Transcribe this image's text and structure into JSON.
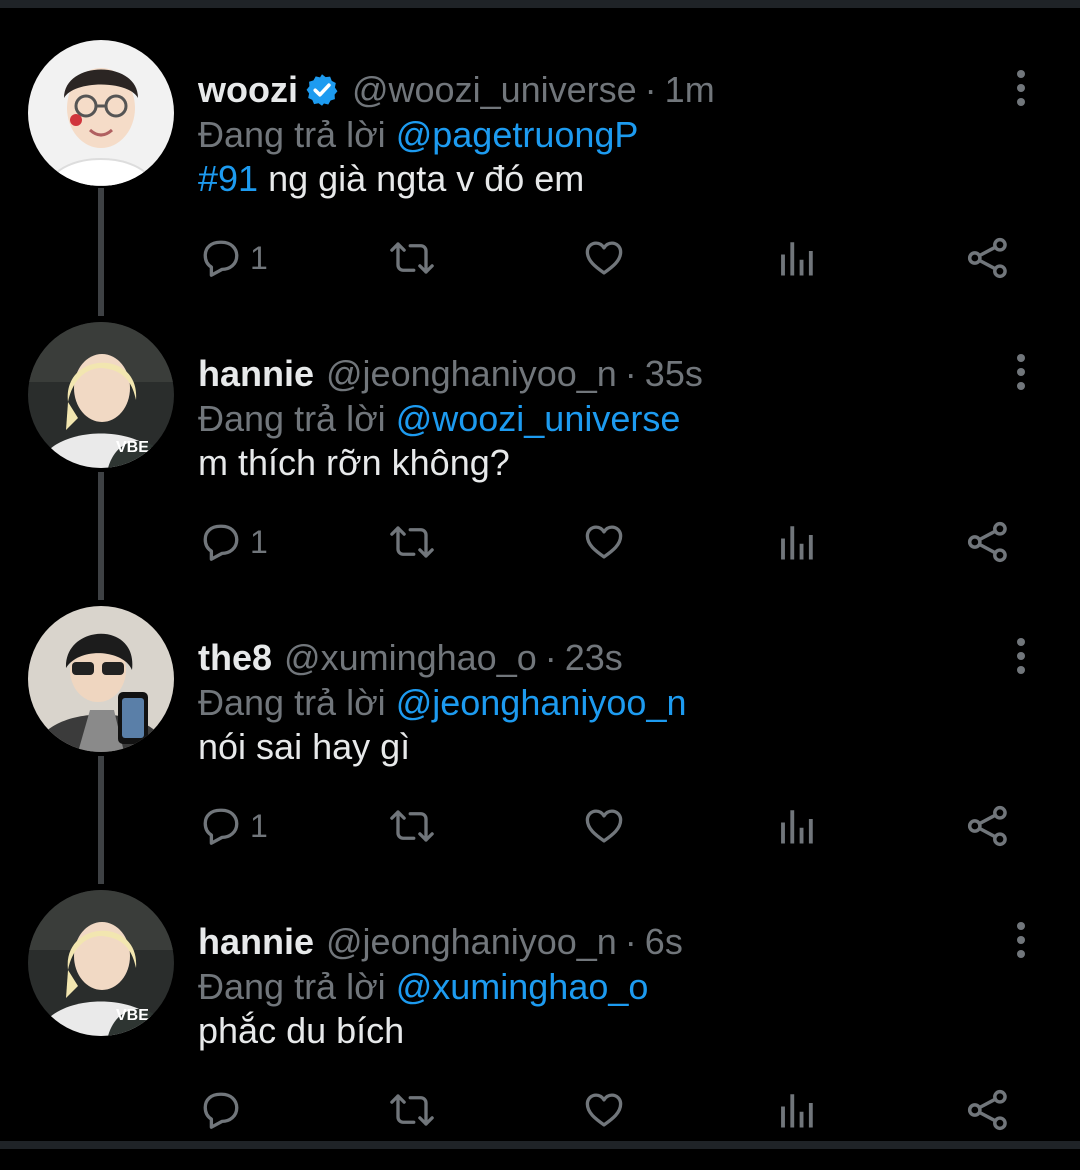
{
  "replying_prefix": "Đang trả lời",
  "tweets": [
    {
      "display_name": "woozi",
      "verified": true,
      "handle": "@woozi_universe",
      "separator": "·",
      "time": "1m",
      "reply_to": "@pagetruongP",
      "hashtag": "#91",
      "text": " ng già ngta v đó em",
      "reply_count": "1",
      "avatar": "avatar-woozi"
    },
    {
      "display_name": "hannie",
      "verified": false,
      "handle": "@jeonghaniyoo_n",
      "separator": "·",
      "time": "35s",
      "reply_to": "@woozi_universe",
      "hashtag": "",
      "text": "m thích rỡn không?",
      "reply_count": "1",
      "avatar": "avatar-hannie"
    },
    {
      "display_name": "the8",
      "verified": false,
      "handle": "@xuminghao_o",
      "separator": "·",
      "time": "23s",
      "reply_to": "@jeonghaniyoo_n",
      "hashtag": "",
      "text": "nói sai hay gì",
      "reply_count": "1",
      "avatar": "avatar-the8"
    },
    {
      "display_name": "hannie",
      "verified": false,
      "handle": "@jeonghaniyoo_n",
      "separator": "·",
      "time": "6s",
      "reply_to": "@xuminghao_o",
      "hashtag": "",
      "text": "phắc du bích",
      "reply_count": "",
      "avatar": "avatar-hannie"
    }
  ],
  "colors": {
    "background": "#000000",
    "text": "#e7e9ea",
    "secondary": "#71767b",
    "accent": "#1d9bf0",
    "thread_line": "#3e4144"
  },
  "icons": [
    "reply-icon",
    "retweet-icon",
    "like-icon",
    "views-icon",
    "share-icon",
    "more-icon",
    "verified-badge-icon"
  ]
}
